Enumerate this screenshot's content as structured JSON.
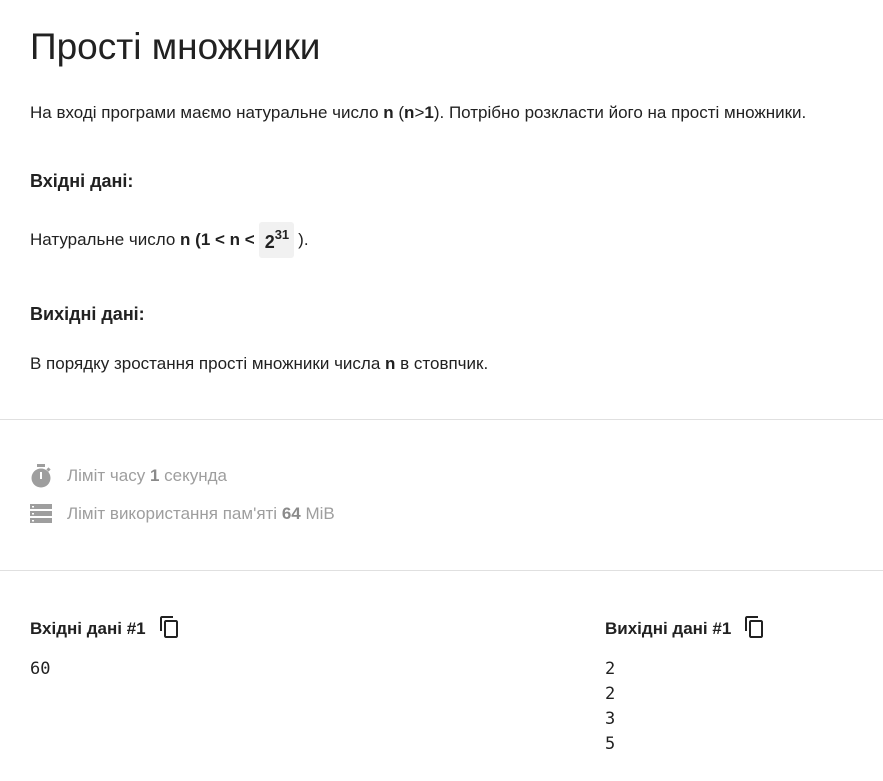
{
  "title": "Прості множники",
  "intro": {
    "before": "На вході програми маємо натуральне число ",
    "n": "n",
    "mid1": " (",
    "n2": "n",
    "gt": ">",
    "one": "1",
    "after": "). Потрібно розкласти його на прості множники."
  },
  "input_section": {
    "heading": "Вхідні дані:",
    "text_before": "Натуральне число ",
    "bold_part": "n (1 < n <",
    "math_base": "2",
    "math_exp": "31",
    "text_after": ")."
  },
  "output_section": {
    "heading": "Вихідні дані:",
    "before": "В порядку зростання прості множники числа ",
    "n": "n",
    "after": " в стовпчик."
  },
  "limits": {
    "time_prefix": "Ліміт часу ",
    "time_value": "1",
    "time_unit": " секунда",
    "memory_prefix": "Ліміт використання пам'яті ",
    "memory_value": "64",
    "memory_unit": " MiB"
  },
  "samples": {
    "input_label": "Вхідні дані #1",
    "input_value": "60",
    "output_label": "Вихідні дані #1",
    "output_value": "2\n2\n3\n5"
  },
  "icons": {
    "timer": "stopwatch-icon",
    "memory": "memory-icon",
    "copy": "copy-icon"
  },
  "colors": {
    "text": "#212121",
    "muted": "#9e9e9e",
    "divider": "#e0e0e0",
    "math_bg": "#f1f1f1"
  }
}
